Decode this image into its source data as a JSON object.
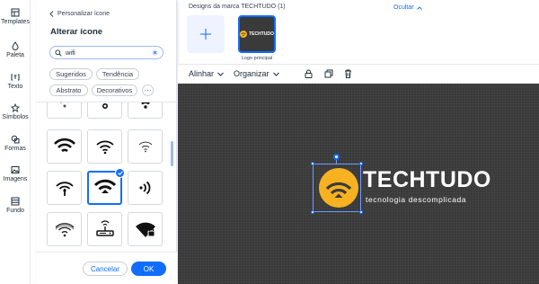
{
  "rail": {
    "items": [
      {
        "label": "Templates",
        "icon": "templates-icon"
      },
      {
        "label": "Paleta",
        "icon": "palette-icon"
      },
      {
        "label": "Texto",
        "icon": "text-icon"
      },
      {
        "label": "Símbolos",
        "icon": "symbols-icon"
      },
      {
        "label": "Formas",
        "icon": "shapes-icon"
      },
      {
        "label": "Imagens",
        "icon": "image-icon"
      },
      {
        "label": "Fundo",
        "icon": "background-icon"
      }
    ]
  },
  "panel": {
    "back_label": "Personalizar ícone",
    "title": "Alterar ícone",
    "search": {
      "value": "wifi"
    },
    "chips": [
      "Sugeridos",
      "Tendência",
      "Abstrato",
      "Decorativos"
    ],
    "more_label": "···",
    "icons": [
      "wifi-icon",
      "wifi-icon",
      "wifi-icon",
      "wifi-icon",
      "wifi-icon",
      "wifi-icon",
      "wifi-icon",
      "wifi-icon",
      "nfc-icon",
      "wifi-icon",
      "router-icon",
      "wifi-lock-icon"
    ],
    "selected_index": 7,
    "cancel_label": "Cancelar",
    "ok_label": "OK"
  },
  "brand": {
    "title": "Designs da marca TECHTUDO (1)",
    "hide_label": "Ocultar",
    "logo_caption": "Logo principal",
    "mini_logo_text": "TECHTUDO"
  },
  "toolbar": {
    "align_label": "Alinhar",
    "arrange_label": "Organizar"
  },
  "canvas": {
    "brand_name": "TECHTUDO",
    "tagline": "tecnologia descomplicada",
    "background_color": "#3a3a3a",
    "logo_color": "#f6b221"
  },
  "colors": {
    "accent": "#116dff"
  }
}
